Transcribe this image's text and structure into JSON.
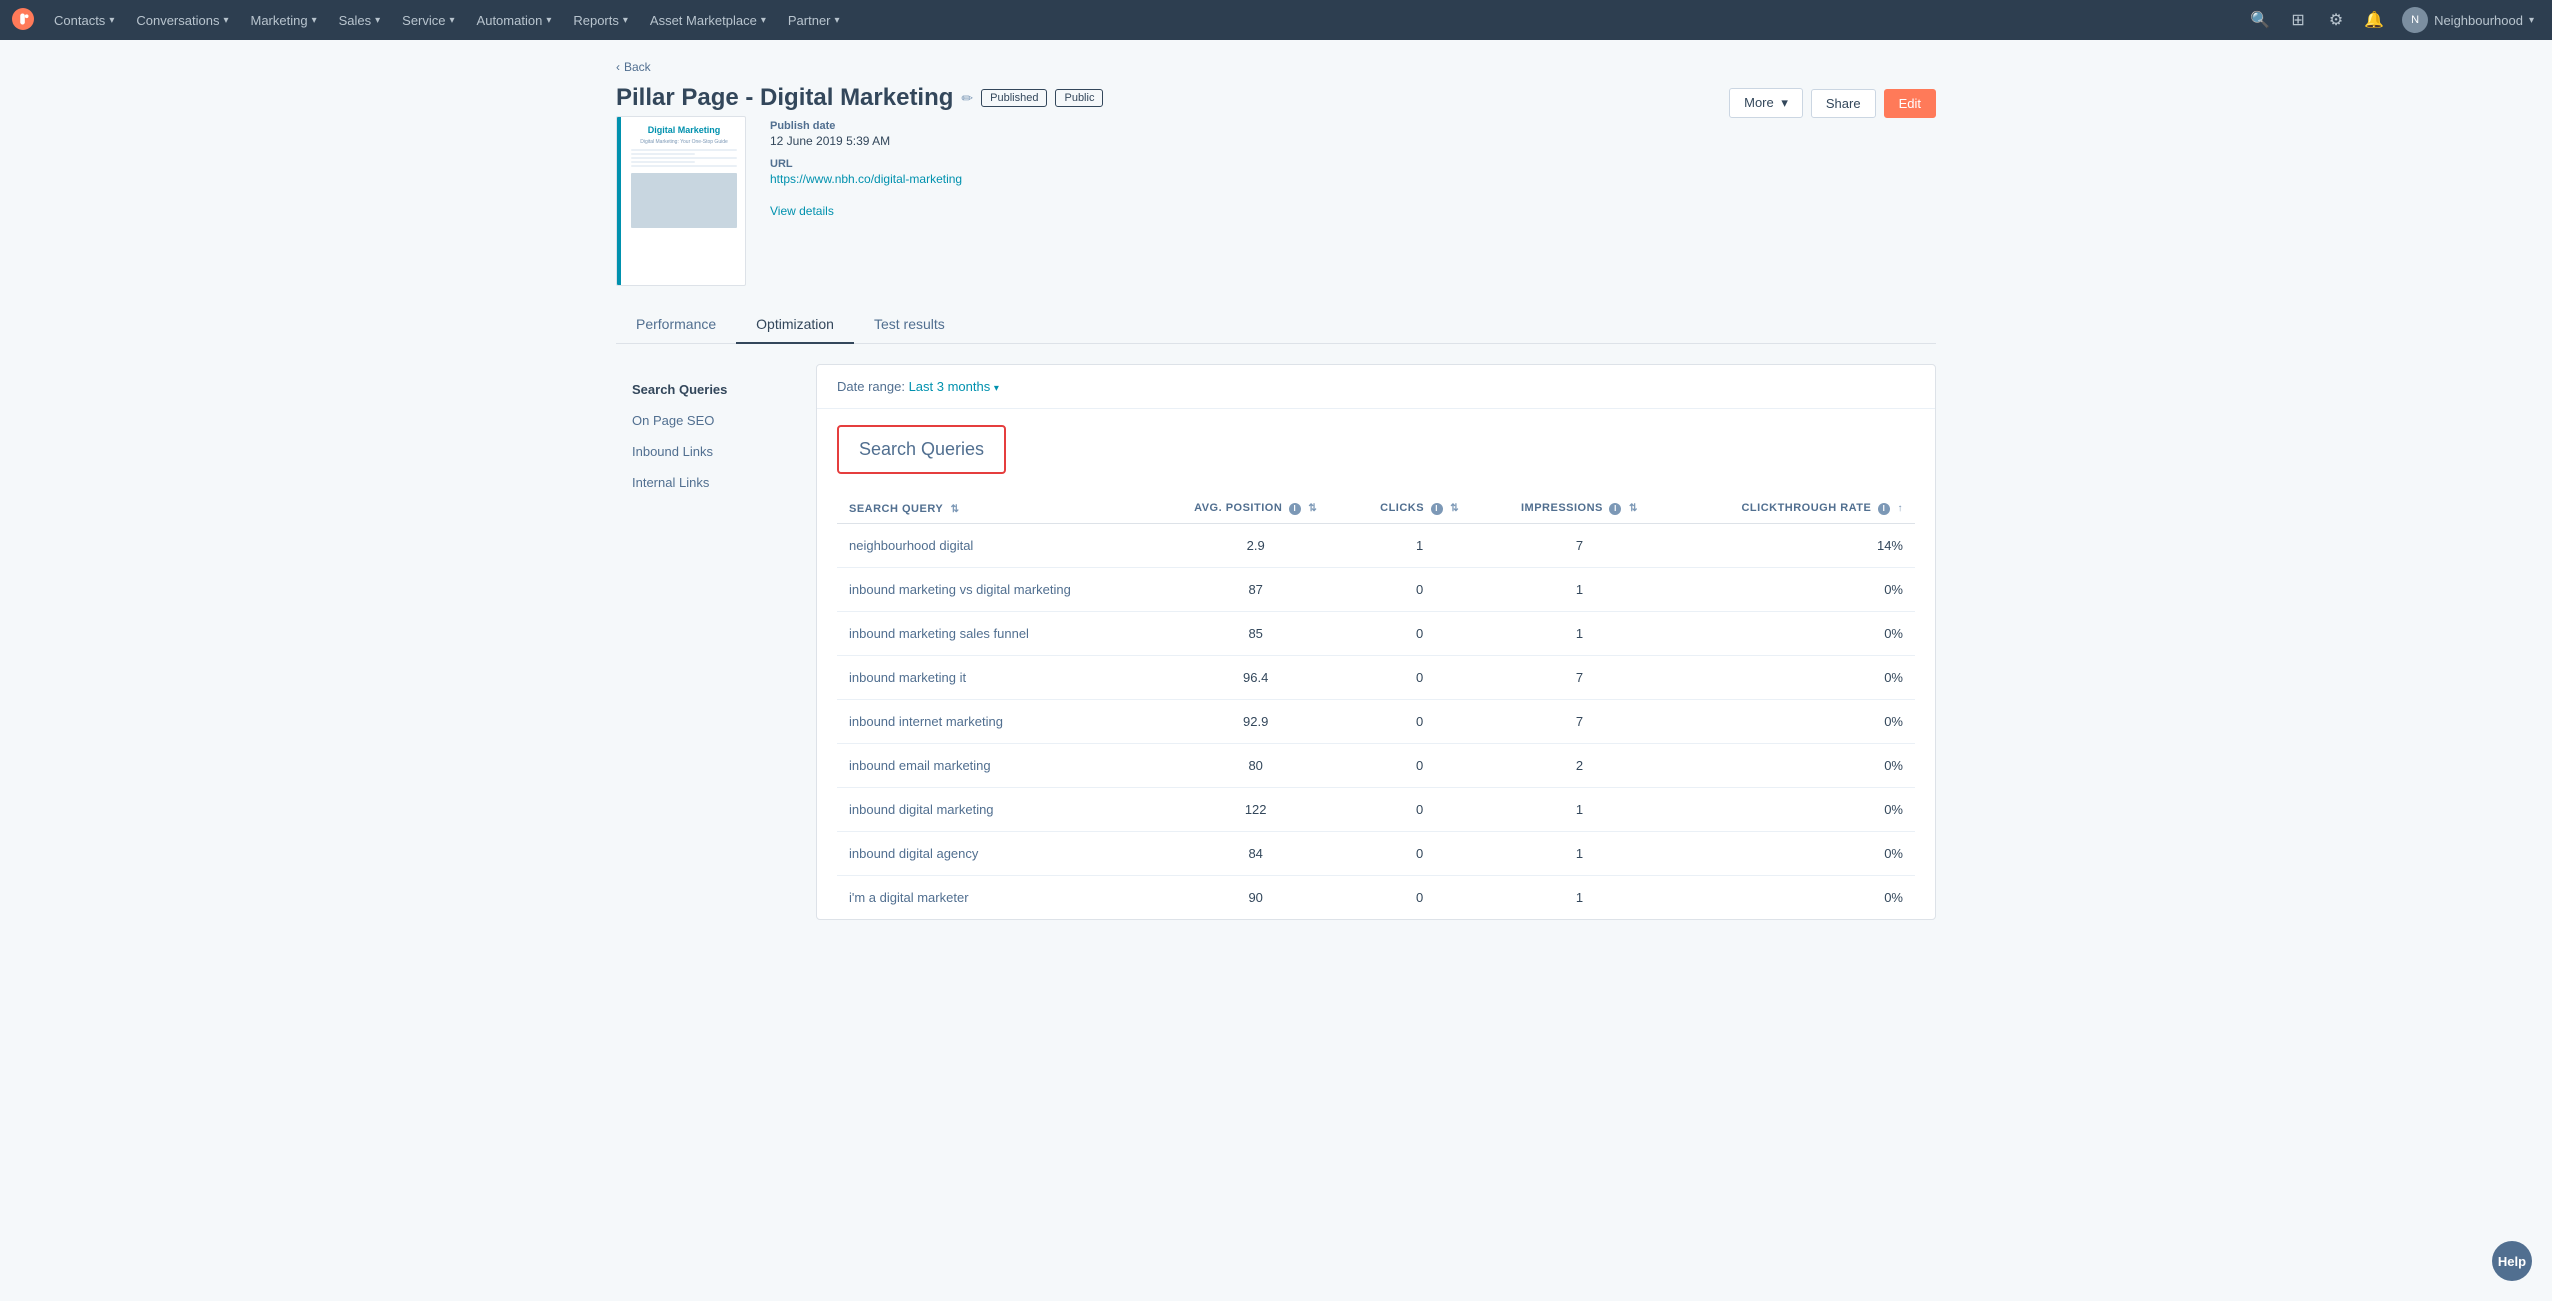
{
  "topnav": {
    "items": [
      {
        "label": "Contacts",
        "has_dropdown": true
      },
      {
        "label": "Conversations",
        "has_dropdown": true
      },
      {
        "label": "Marketing",
        "has_dropdown": true
      },
      {
        "label": "Sales",
        "has_dropdown": true
      },
      {
        "label": "Service",
        "has_dropdown": true
      },
      {
        "label": "Automation",
        "has_dropdown": true
      },
      {
        "label": "Reports",
        "has_dropdown": true
      },
      {
        "label": "Asset Marketplace",
        "has_dropdown": true
      },
      {
        "label": "Partner",
        "has_dropdown": true
      }
    ],
    "user": {
      "name": "Neighbourhood",
      "avatar_initials": "N"
    }
  },
  "page": {
    "back_label": "Back",
    "title": "Pillar Page - Digital Marketing",
    "status_badge": "Published",
    "visibility_badge": "Public",
    "publish_date_label": "Publish date",
    "publish_date_value": "12 June 2019 5:39 AM",
    "url_label": "URL",
    "url_value": "https://www.nbh.co/digital-marketing",
    "view_details_label": "View details"
  },
  "header_actions": {
    "more_label": "More",
    "share_label": "Share",
    "edit_label": "Edit"
  },
  "tabs": [
    {
      "label": "Performance",
      "active": false
    },
    {
      "label": "Optimization",
      "active": true
    },
    {
      "label": "Test results",
      "active": false
    }
  ],
  "sidebar": {
    "items": [
      {
        "label": "Search Queries",
        "active": true
      },
      {
        "label": "On Page SEO",
        "active": false
      },
      {
        "label": "Inbound Links",
        "active": false
      },
      {
        "label": "Internal Links",
        "active": false
      }
    ]
  },
  "panel": {
    "date_range_label": "Date range:",
    "date_range_value": "Last 3 months",
    "search_queries_title": "Search Queries",
    "table": {
      "columns": [
        {
          "label": "SEARCH QUERY",
          "key": "query",
          "sortable": true
        },
        {
          "label": "AVG. POSITION",
          "key": "avg_position",
          "sortable": true,
          "has_info": true
        },
        {
          "label": "CLICKS",
          "key": "clicks",
          "sortable": true,
          "has_info": true
        },
        {
          "label": "IMPRESSIONS",
          "key": "impressions",
          "sortable": true,
          "has_info": true
        },
        {
          "label": "CLICKTHROUGH RATE",
          "key": "ctr",
          "sortable": true,
          "has_info": true
        }
      ],
      "rows": [
        {
          "query": "neighbourhood digital",
          "avg_position": "2.9",
          "clicks": "1",
          "impressions": "7",
          "ctr": "14%"
        },
        {
          "query": "inbound marketing vs digital marketing",
          "avg_position": "87",
          "clicks": "0",
          "impressions": "1",
          "ctr": "0%"
        },
        {
          "query": "inbound marketing sales funnel",
          "avg_position": "85",
          "clicks": "0",
          "impressions": "1",
          "ctr": "0%"
        },
        {
          "query": "inbound marketing it",
          "avg_position": "96.4",
          "clicks": "0",
          "impressions": "7",
          "ctr": "0%"
        },
        {
          "query": "inbound internet marketing",
          "avg_position": "92.9",
          "clicks": "0",
          "impressions": "7",
          "ctr": "0%"
        },
        {
          "query": "inbound email marketing",
          "avg_position": "80",
          "clicks": "0",
          "impressions": "2",
          "ctr": "0%"
        },
        {
          "query": "inbound digital marketing",
          "avg_position": "122",
          "clicks": "0",
          "impressions": "1",
          "ctr": "0%"
        },
        {
          "query": "inbound digital agency",
          "avg_position": "84",
          "clicks": "0",
          "impressions": "1",
          "ctr": "0%"
        },
        {
          "query": "i'm a digital marketer",
          "avg_position": "90",
          "clicks": "0",
          "impressions": "1",
          "ctr": "0%"
        }
      ]
    }
  },
  "help_button_label": "Help"
}
